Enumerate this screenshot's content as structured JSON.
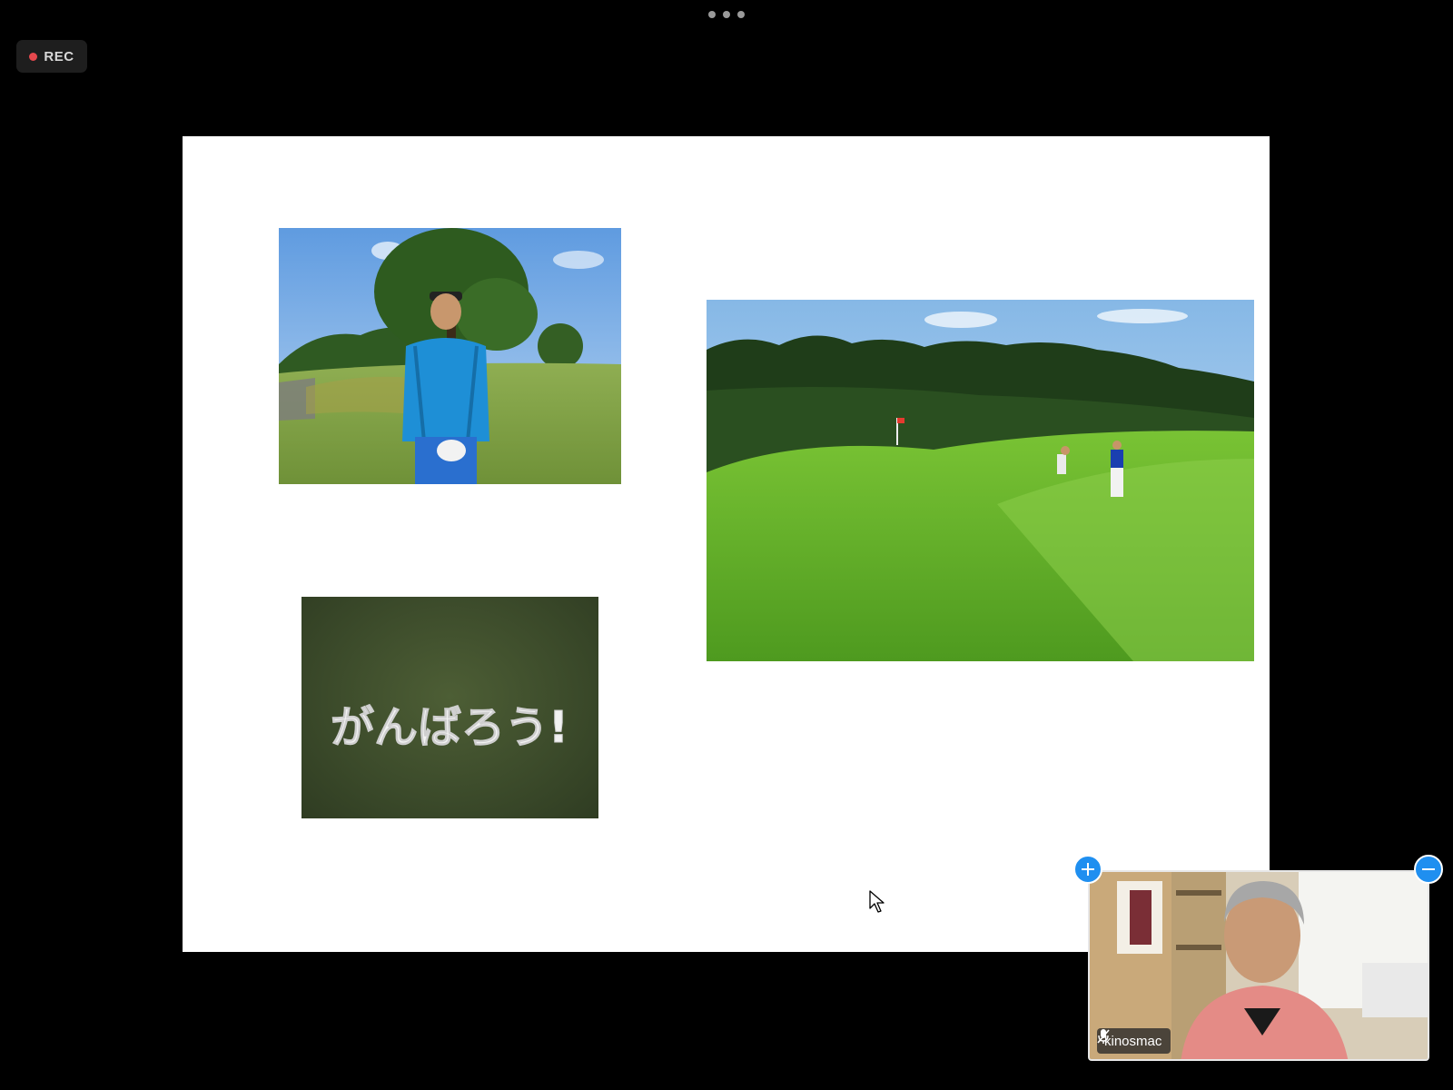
{
  "recording": {
    "label": "REC",
    "indicator_color": "#e5484d"
  },
  "slide": {
    "photos": [
      {
        "name": "golfer-portrait"
      },
      {
        "name": "golf-course-green"
      },
      {
        "name": "golf-balls-message",
        "message": "がんばろう!"
      }
    ]
  },
  "self_view": {
    "participant_name": "kinosmac"
  },
  "colors": {
    "accent": "#1f8ff0",
    "background": "#000000",
    "slide": "#ffffff"
  },
  "icons": [
    "more-icon",
    "rec-dot-icon",
    "mouse-cursor-icon",
    "mic-muted-icon",
    "plus-icon",
    "minus-icon"
  ]
}
